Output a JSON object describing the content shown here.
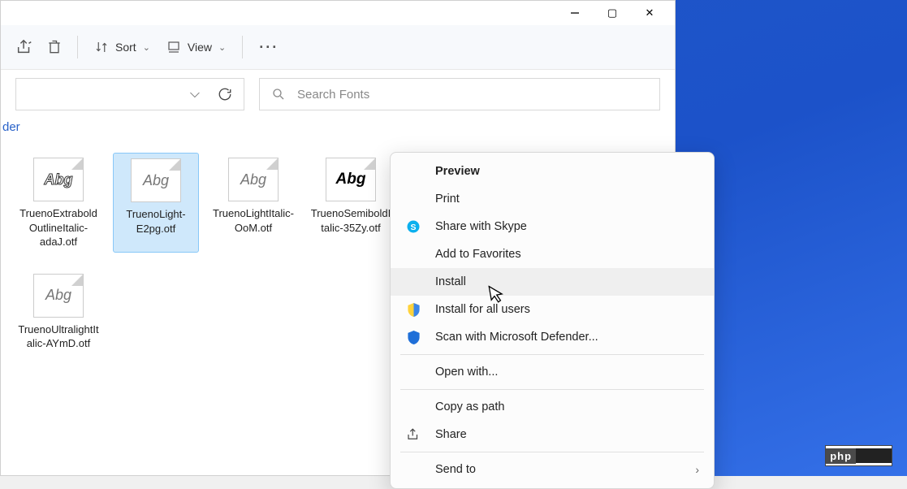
{
  "titlebar": {
    "maximize_glyph": "▢",
    "close_glyph": "✕"
  },
  "toolbar": {
    "sort_label": "Sort",
    "view_label": "View"
  },
  "address": {
    "crumb_tail": "der"
  },
  "search": {
    "placeholder": "Search Fonts"
  },
  "files": [
    {
      "name": "TruenoExtraboldOutlineItalic-adaJ.otf",
      "style": "outline",
      "glyph": "Abg"
    },
    {
      "name": "TruenoLight-E2pg.otf",
      "style": "light",
      "glyph": "Abg",
      "selected": true
    },
    {
      "name": "TruenoLightItalic-OoM.otf",
      "style": "light",
      "glyph": "Abg"
    },
    {
      "name": "TruenoSemiboldItalic-35Zy.otf",
      "style": "bold",
      "glyph": "Abg"
    },
    {
      "name": "TruenoUltralightItalic-AYmD.otf",
      "style": "light",
      "glyph": "Abg"
    }
  ],
  "context_menu": {
    "preview": "Preview",
    "print": "Print",
    "skype": "Share with Skype",
    "favorites": "Add to Favorites",
    "install": "Install",
    "install_all": "Install for all users",
    "scan": "Scan with Microsoft Defender...",
    "open_with": "Open with...",
    "copy_path": "Copy as path",
    "share": "Share",
    "send_to": "Send to"
  },
  "watermark": {
    "left": "php",
    "right": "····"
  }
}
